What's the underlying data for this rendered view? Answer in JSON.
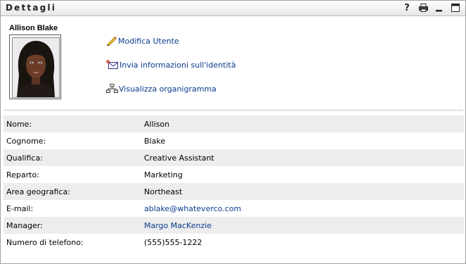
{
  "panel": {
    "title": "Dettagli",
    "icons": [
      "help-icon",
      "print-icon",
      "minimize-icon",
      "maximize-icon"
    ],
    "help_glyph": "?"
  },
  "user": {
    "display_name": "Allison Blake"
  },
  "actions": [
    {
      "label": "Modifica Utente",
      "icon": "pencil-icon"
    },
    {
      "label": "Invia informazioni sull'identità",
      "icon": "mail-icon"
    },
    {
      "label": "Visualizza organigramma",
      "icon": "org-chart-icon"
    }
  ],
  "details": [
    {
      "key": "Nome:",
      "value": "Allison"
    },
    {
      "key": "Cognome:",
      "value": "Blake"
    },
    {
      "key": "Qualifica:",
      "value": "Creative Assistant"
    },
    {
      "key": "Reparto:",
      "value": "Marketing"
    },
    {
      "key": "Area geografica:",
      "value": "Northeast"
    },
    {
      "key": "E-mail:",
      "value": "ablake@whateverco.com"
    },
    {
      "key": "Manager:",
      "value": "Margo MacKenzie"
    },
    {
      "key": "Numero di telefono:",
      "value": "(555)555-1222"
    }
  ],
  "colors": {
    "link": "#0b3a8e",
    "row_shade": "#ededed"
  }
}
